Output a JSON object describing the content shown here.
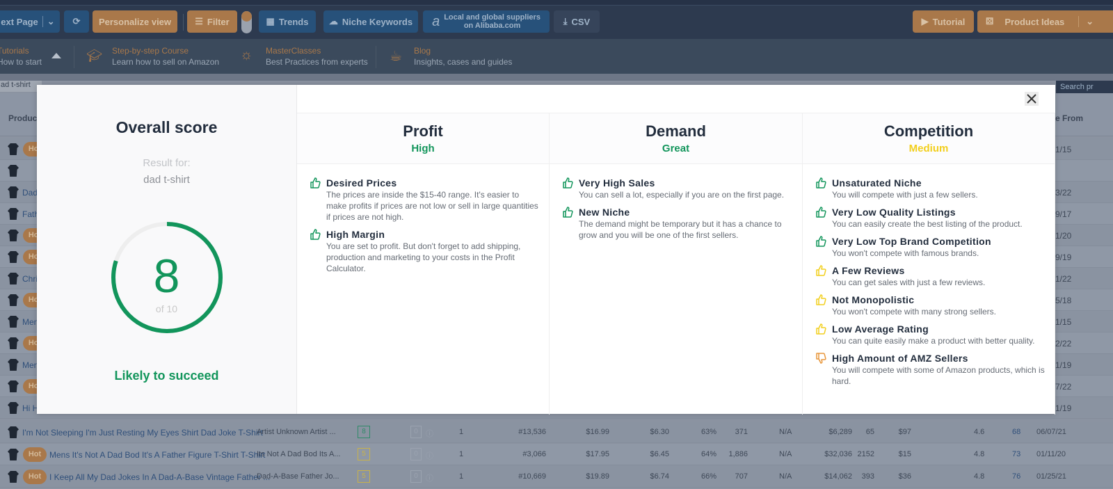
{
  "toolbar": {
    "next_page": "ext Page",
    "personalize": "Personalize view",
    "filter": "Filter",
    "trends": "Trends",
    "niche_keywords": "Niche Keywords",
    "alibaba_line1": "Local and global suppliers",
    "alibaba_line2": "on Alibaba.com",
    "csv": "CSV",
    "tutorial": "Tutorial",
    "product_ideas": "Product Ideas"
  },
  "nav": [
    {
      "title": "Tutorials",
      "subtitle": "How to start"
    },
    {
      "title": "Step-by-step Course",
      "subtitle": "Learn how to sell on Amazon"
    },
    {
      "title": "MasterClasses",
      "subtitle": "Best Practices from experts"
    },
    {
      "title": "Blog",
      "subtitle": "Insights, cases and guides"
    }
  ],
  "search": {
    "value": "ad t-shirt",
    "right_placeholder": "Search pr"
  },
  "table": {
    "headers": {
      "product": "Product",
      "date_from": "e From"
    },
    "hot_label": "Hot",
    "partial_rows": [
      {
        "hot": true,
        "title": "",
        "date": "1/15"
      },
      {
        "hot": false,
        "title": "",
        "date": ""
      },
      {
        "hot": false,
        "title": "Dad",
        "date": "3/22"
      },
      {
        "hot": false,
        "title": "Fath",
        "date": "9/17"
      },
      {
        "hot": true,
        "title": "",
        "date": "1/20"
      },
      {
        "hot": true,
        "title": "",
        "date": "9/19"
      },
      {
        "hot": false,
        "title": "Chri",
        "date": "1/22"
      },
      {
        "hot": true,
        "title": "",
        "date": "5/18"
      },
      {
        "hot": false,
        "title": "Men",
        "date": "1/15"
      },
      {
        "hot": true,
        "title": "",
        "date": "2/22"
      },
      {
        "hot": false,
        "title": "Men",
        "date": "1/19"
      },
      {
        "hot": true,
        "title": "",
        "date": "7/22"
      },
      {
        "hot": false,
        "title": "Hi H",
        "date": "1/19"
      }
    ],
    "rows": [
      {
        "hot": false,
        "title": "I'm Not Sleeping I'm Just Resting My Eyes Shirt Dad Joke T-Shirt",
        "brand": "Artist Unknown Artist ...",
        "score": "8",
        "reviews_box": "0",
        "sellers": "1",
        "rank": "#13,536",
        "price": "$16.99",
        "fee": "$6.30",
        "margin": "63%",
        "sales": "371",
        "na": "N/A",
        "revenue": "$6,289",
        "reviews": "65",
        "rev_per_review": "$97",
        "rating": "4.6",
        "lqs": "68",
        "date": "06/07/21"
      },
      {
        "hot": true,
        "title": "Mens It's Not A Dad Bod It's A Father Figure T-Shirt T-Shirt",
        "brand": "Its Not A Dad Bod Its A...",
        "score": "5",
        "reviews_box": "0",
        "sellers": "1",
        "rank": "#3,066",
        "price": "$17.95",
        "fee": "$6.45",
        "margin": "64%",
        "sales": "1,886",
        "na": "N/A",
        "revenue": "$32,036",
        "reviews": "2152",
        "rev_per_review": "$15",
        "rating": "4.8",
        "lqs": "73",
        "date": "01/11/20"
      },
      {
        "hot": true,
        "title": "I Keep All My Dad Jokes In A Dad-A-Base Vintage Father ...",
        "brand": "Dad-A-Base Father Jo...",
        "score": "5",
        "reviews_box": "0",
        "sellers": "1",
        "rank": "#10,669",
        "price": "$19.89",
        "fee": "$6.74",
        "margin": "66%",
        "sales": "707",
        "na": "N/A",
        "revenue": "$14,062",
        "reviews": "393",
        "rev_per_review": "$36",
        "rating": "4.8",
        "lqs": "76",
        "date": "01/25/21"
      }
    ]
  },
  "modal": {
    "title": "Overall score",
    "result_for": "Result for:",
    "keyword": "dad t-shirt",
    "score": "8",
    "score_value": 8,
    "score_max": 10,
    "score_of": "of 10",
    "verdict": "Likely to succeed",
    "colors": {
      "green": "#12955b",
      "yellow": "#f2cf1d",
      "orange": "#e8963a"
    },
    "columns": [
      {
        "title": "Profit",
        "level": "High",
        "level_color": "#12955b",
        "items": [
          {
            "icon": "thumbs-up",
            "color": "#12955b",
            "title": "Desired Prices",
            "desc": "The prices are inside the $15-40 range. It's easier to make profits if prices are not low or sell in large quantities if prices are not high."
          },
          {
            "icon": "thumbs-up",
            "color": "#12955b",
            "title": "High Margin",
            "desc": "You are set to profit. But don't forget to add shipping, production and marketing to your costs in the Profit Calculator."
          }
        ]
      },
      {
        "title": "Demand",
        "level": "Great",
        "level_color": "#12955b",
        "items": [
          {
            "icon": "thumbs-up",
            "color": "#12955b",
            "title": "Very High Sales",
            "desc": "You can sell a lot, especially if you are on the first page."
          },
          {
            "icon": "thumbs-up",
            "color": "#12955b",
            "title": "New Niche",
            "desc": "The demand might be temporary but it has a chance to grow and you will be one of the first sellers."
          }
        ]
      },
      {
        "title": "Competition",
        "level": "Medium",
        "level_color": "#f2cf1d",
        "items": [
          {
            "icon": "thumbs-up",
            "color": "#12955b",
            "title": "Unsaturated Niche",
            "desc": "You will compete with just a few sellers."
          },
          {
            "icon": "thumbs-up",
            "color": "#12955b",
            "title": "Very Low Quality Listings",
            "desc": "You can easily create the best listing of the product."
          },
          {
            "icon": "thumbs-up",
            "color": "#12955b",
            "title": "Very Low Top Brand Competition",
            "desc": "You won't compete with famous brands."
          },
          {
            "icon": "thumbs-up",
            "color": "#f2cf1d",
            "title": "A Few Reviews",
            "desc": "You can get sales with just a few reviews."
          },
          {
            "icon": "thumbs-up",
            "color": "#f2cf1d",
            "title": "Not Monopolistic",
            "desc": "You won't compete with many strong sellers."
          },
          {
            "icon": "thumbs-up",
            "color": "#f2cf1d",
            "title": "Low Average Rating",
            "desc": "You can quite easily make a product with better quality."
          },
          {
            "icon": "thumbs-down",
            "color": "#e8963a",
            "title": "High Amount of AMZ Sellers",
            "desc": "You will compete with some of Amazon products, which is hard."
          }
        ]
      }
    ]
  }
}
